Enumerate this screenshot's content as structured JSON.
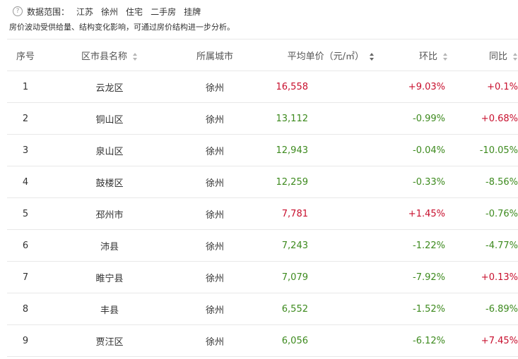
{
  "scope": {
    "label": "数据范围：",
    "tags": [
      "江苏",
      "徐州",
      "住宅",
      "二手房",
      "挂牌"
    ]
  },
  "note": "房价波动受供给量、结构变化影响，可通过房价结构进一步分析。",
  "table": {
    "headers": {
      "index": "序号",
      "district": "区市县名称",
      "city": "所属城市",
      "price": "平均单价（元/㎡）",
      "mom": "环比",
      "yoy": "同比"
    },
    "rows": [
      {
        "index": "1",
        "district": "云龙区",
        "city": "徐州",
        "price": "16,558",
        "mom": "+9.03%",
        "yoy": "+0.1%"
      },
      {
        "index": "2",
        "district": "铜山区",
        "city": "徐州",
        "price": "13,112",
        "mom": "-0.99%",
        "yoy": "+0.68%"
      },
      {
        "index": "3",
        "district": "泉山区",
        "city": "徐州",
        "price": "12,943",
        "mom": "-0.04%",
        "yoy": "-10.05%"
      },
      {
        "index": "4",
        "district": "鼓楼区",
        "city": "徐州",
        "price": "12,259",
        "mom": "-0.33%",
        "yoy": "-8.56%"
      },
      {
        "index": "5",
        "district": "邳州市",
        "city": "徐州",
        "price": "7,781",
        "mom": "+1.45%",
        "yoy": "-0.76%"
      },
      {
        "index": "6",
        "district": "沛县",
        "city": "徐州",
        "price": "7,243",
        "mom": "-1.22%",
        "yoy": "-4.77%"
      },
      {
        "index": "7",
        "district": "睢宁县",
        "city": "徐州",
        "price": "7,079",
        "mom": "-7.92%",
        "yoy": "+0.13%"
      },
      {
        "index": "8",
        "district": "丰县",
        "city": "徐州",
        "price": "6,552",
        "mom": "-1.52%",
        "yoy": "-6.89%"
      },
      {
        "index": "9",
        "district": "贾汪区",
        "city": "徐州",
        "price": "6,056",
        "mom": "-6.12%",
        "yoy": "+7.45%"
      }
    ],
    "price_colors": [
      "red",
      "green",
      "green",
      "green",
      "red",
      "green",
      "green",
      "green",
      "green"
    ]
  },
  "colors": {
    "up": "#c8102e",
    "down": "#3d8a1e"
  }
}
